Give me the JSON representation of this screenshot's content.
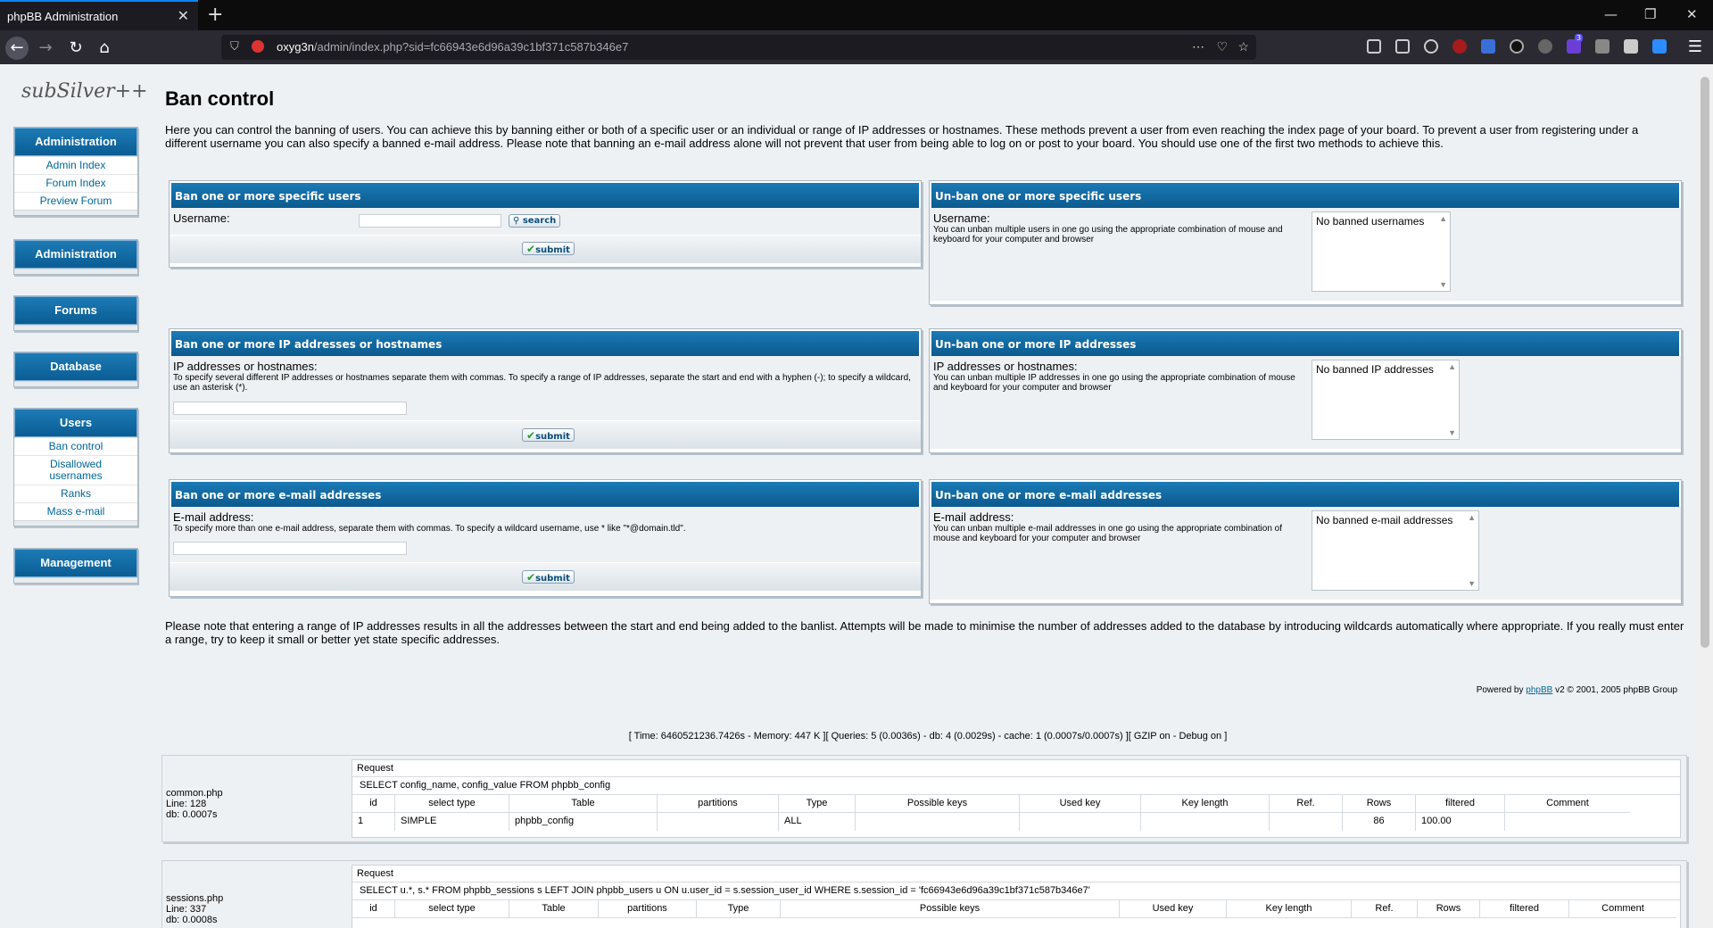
{
  "browser": {
    "tab_title": "phpBB Administration",
    "url_host": "oxyg3n",
    "url_path": "/admin/index.php?sid=fc66943e6d96a39c1bf371c587b346e7",
    "ext_badge": "3"
  },
  "sidebar": {
    "logo": "subSilver++",
    "groups": [
      {
        "title": "Administration",
        "items": [
          "Admin Index",
          "Forum Index",
          "Preview Forum"
        ]
      },
      {
        "title": "Administration",
        "items": []
      },
      {
        "title": "Forums",
        "items": []
      },
      {
        "title": "Database",
        "items": []
      },
      {
        "title": "Users",
        "items": [
          "Ban control",
          "Disallowed usernames",
          "Ranks",
          "Mass e-mail"
        ]
      },
      {
        "title": "Management",
        "items": []
      }
    ]
  },
  "main": {
    "title": "Ban control",
    "intro": "Here you can control the banning of users. You can achieve this by banning either or both of a specific user or an individual or range of IP addresses or hostnames. These methods prevent a user from even reaching the index page of your board. To prevent a user from registering under a different username you can also specify a banned e-mail address. Please note that banning an e-mail address alone will not prevent that user from being able to log on or post to your board. You should use one of the first two methods to achieve this.",
    "ban_user": {
      "title": "Ban one or more specific users",
      "label": "Username:",
      "search": "search",
      "submit": "submit"
    },
    "unban_user": {
      "title": "Un-ban one or more specific users",
      "label": "Username:",
      "help": "You can unban multiple users in one go using the appropriate combination of mouse and keyboard for your computer and browser",
      "empty": "No banned usernames"
    },
    "ban_ip": {
      "title": "Ban one or more IP addresses or hostnames",
      "label": "IP addresses or hostnames:",
      "help": "To specify several different IP addresses or hostnames separate them with commas. To specify a range of IP addresses, separate the start and end with a hyphen (-); to specify a wildcard, use an asterisk (*).",
      "submit": "submit"
    },
    "unban_ip": {
      "title": "Un-ban one or more IP addresses",
      "label": "IP addresses or hostnames:",
      "help": "You can unban multiple IP addresses in one go using the appropriate combination of mouse and keyboard for your computer and browser",
      "empty": "No banned IP addresses"
    },
    "ban_email": {
      "title": "Ban one or more e-mail addresses",
      "label": "E-mail address:",
      "help": "To specify more than one e-mail address, separate them with commas. To specify a wildcard username, use * like \"*@domain.tld\".",
      "submit": "submit"
    },
    "unban_email": {
      "title": "Un-ban one or more e-mail addresses",
      "label": "E-mail address:",
      "help": "You can unban multiple e-mail addresses in one go using the appropriate combination of mouse and keyboard for your computer and browser",
      "empty": "No banned e-mail addresses"
    },
    "note": "Please note that entering a range of IP addresses results in all the addresses between the start and end being added to the banlist. Attempts will be made to minimise the number of addresses added to the database by introducing wildcards automatically where appropriate. If you really must enter a range, try to keep it small or better yet state specific addresses.",
    "powered_pre": "Powered by ",
    "powered_link": "phpBB",
    "powered_post": " v2 © 2001, 2005 phpBB Group",
    "debug": "[ Time: 6460521236.7426s - Memory: 447 K ][ Queries: 5 (0.0036s) - db: 4 (0.0029s) - cache: 1 (0.0007s/0.0007s) ][ GZIP on - Debug on ]"
  },
  "queries": {
    "request_label": "Request",
    "q1": {
      "file": "common.php",
      "line": "Line: 128",
      "db": "db: 0.0007s",
      "sql": "SELECT config_name, config_value FROM phpbb_config",
      "headers": [
        "id",
        "select type",
        "Table",
        "partitions",
        "Type",
        "Possible keys",
        "Used key",
        "Key length",
        "Ref.",
        "Rows",
        "filtered",
        "Comment"
      ],
      "row": [
        "1",
        "SIMPLE",
        "phpbb_config",
        "",
        "ALL",
        "",
        "",
        "",
        "",
        "86",
        "100.00",
        ""
      ]
    },
    "q2": {
      "file": "sessions.php",
      "line": "Line: 337",
      "db": "db: 0.0008s",
      "sql": "SELECT u.*, s.* FROM phpbb_sessions s LEFT JOIN phpbb_users u ON u.user_id = s.session_user_id WHERE s.session_id = 'fc66943e6d96a39c1bf371c587b346e7'",
      "headers": [
        "id",
        "select type",
        "Table",
        "partitions",
        "Type",
        "Possible keys",
        "Used key",
        "Key length",
        "Ref.",
        "Rows",
        "filtered",
        "Comment"
      ]
    }
  }
}
